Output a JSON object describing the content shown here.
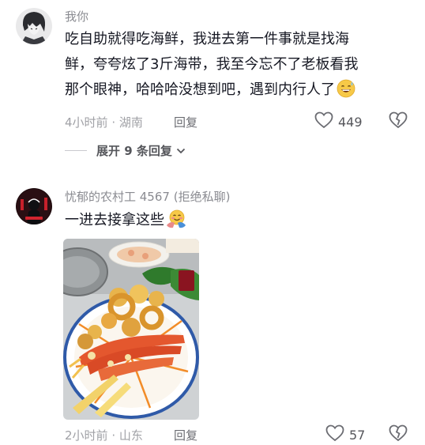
{
  "comment1": {
    "username": "我你",
    "lines": [
      "吃自助就得吃海鲜，我进去第一件事就是找海",
      "鲜，夸夸炫了3斤海带，我至今忘不了老板看我",
      "那个眼神，哈哈哈没想到吧，遇到内行人了"
    ],
    "emoji": "grinning-sweat-emoji",
    "time": "4小时前",
    "location": "湖南",
    "reply_label": "回复",
    "likes": "449"
  },
  "expand": {
    "label": "展开 9 条回复"
  },
  "comment2": {
    "username": "忧郁的农村工 4567 (拒绝私聊)",
    "text": "一进去接拿这些",
    "emoji": "hugging-face-emoji",
    "time": "2小时前",
    "location": "山东",
    "reply_label": "回复",
    "likes": "57"
  },
  "icons": {
    "like": "heart-outline-icon",
    "dislike": "broken-heart-icon",
    "expand": "chevron-down-icon"
  }
}
